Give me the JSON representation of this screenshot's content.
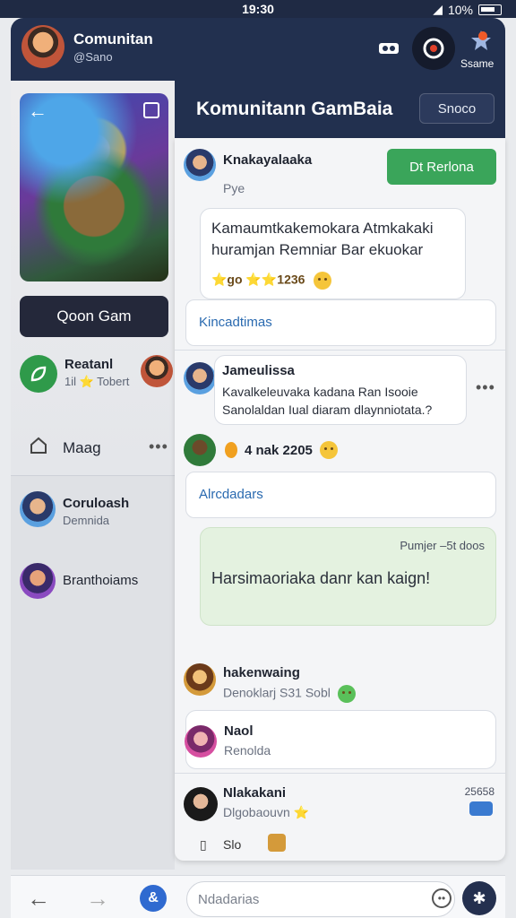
{
  "status": {
    "time": "19:30",
    "battery": "10%"
  },
  "app": {
    "title": "Comunitan",
    "subtitle": "@Sano"
  },
  "top_actions": {
    "badge_label": "Ssame"
  },
  "sidebar": {
    "join_label": "Qoon Gam",
    "items": [
      {
        "name": "Reatanl",
        "sub": "1il ⭐ Tobert"
      },
      {
        "name": "Maag",
        "sub": ""
      },
      {
        "name": "Coruloash",
        "sub": "Demnida"
      },
      {
        "name": "Branthoiams",
        "sub": ""
      }
    ]
  },
  "main": {
    "title": "Komunitann GamBaia",
    "search_label": "Snoco",
    "posts": [
      {
        "name": "Knakayalaaka",
        "sub": "Pye",
        "action": "Dt Rerlona",
        "text": "Kamaumtkakemokara Atmkakaki huramjan Remniar Bar ekuokar",
        "reactions": "⭐go ⭐⭐1236",
        "link": "Kincadtimas"
      },
      {
        "name": "Jameulissa",
        "text": "Kavalkeleuvaka kadana Ran Isooie Sanolaldan Iual diaram dlaynniotata.?",
        "reactions": "4 nak 2205",
        "link": "Alrcdadars"
      },
      {
        "meta": "Pumjer –5t doos",
        "text": "Harsimaoriaka danr kan kaign!"
      },
      {
        "name": "hakenwaing",
        "sub": "Denoklarj S31 Sobl"
      },
      {
        "name": "Naol",
        "sub": "Renolda"
      },
      {
        "name": "Nlakakani",
        "sub": "Dlgobaouvn ⭐",
        "time": "25658",
        "extra": "Slo"
      }
    ]
  },
  "bottom": {
    "input_placeholder": "Ndadarias"
  }
}
